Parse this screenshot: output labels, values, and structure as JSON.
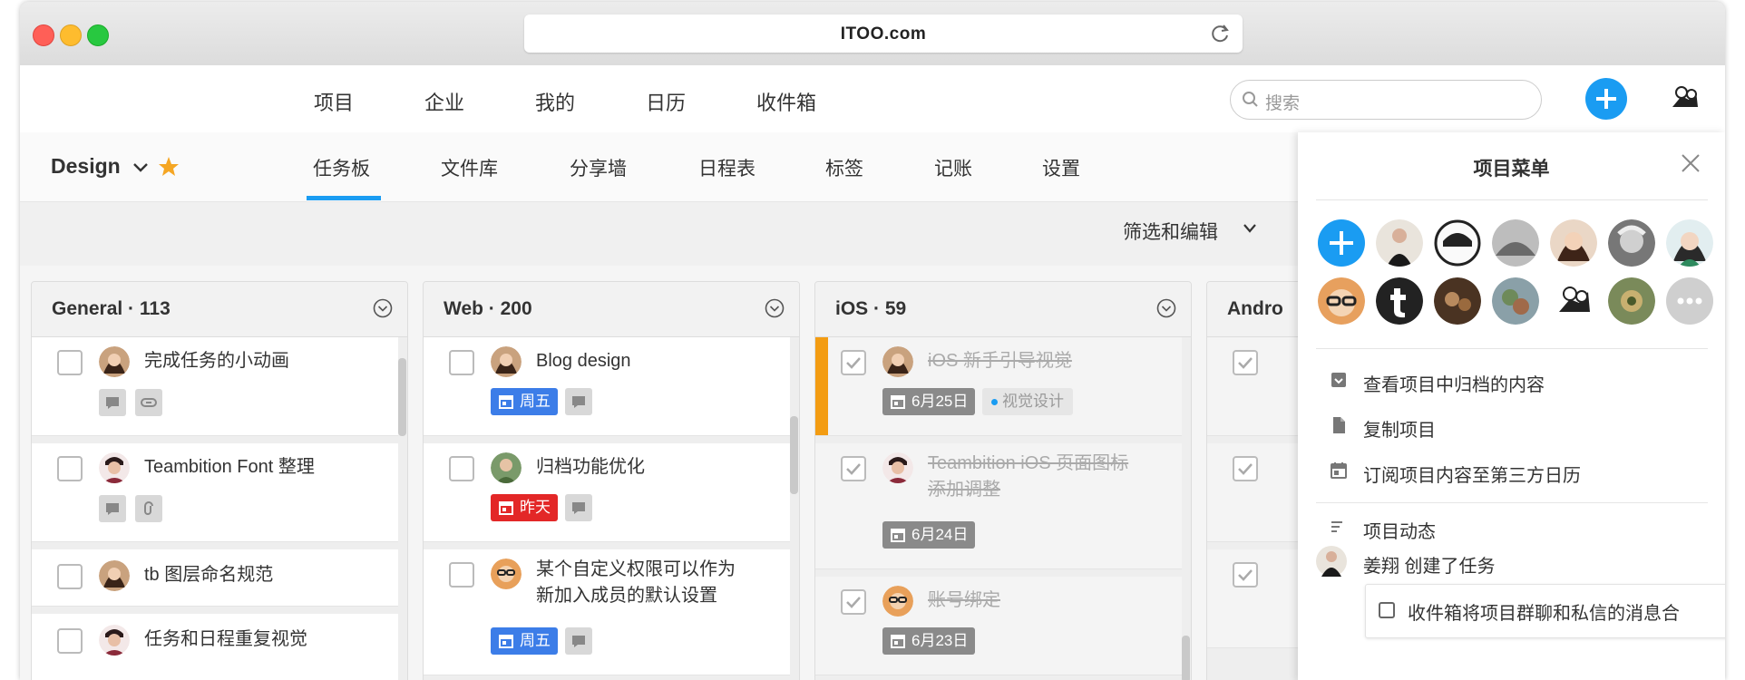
{
  "window": {
    "url": "ITOO.com"
  },
  "topnav": {
    "items": [
      "项目",
      "企业",
      "我的",
      "日历",
      "收件箱"
    ],
    "search_placeholder": "搜索"
  },
  "project": {
    "name": "Design",
    "tabs": [
      "任务板",
      "文件库",
      "分享墙",
      "日程表",
      "标签",
      "记账",
      "设置"
    ],
    "active_tab": "任务板",
    "filter_label": "筛选和编辑"
  },
  "columns": [
    {
      "title": "General · 113",
      "cards": [
        {
          "title": "完成任务的小动画",
          "done": false
        },
        {
          "title": "Teambition Font 整理",
          "done": false
        },
        {
          "title": "tb 图层命名规范",
          "done": false
        },
        {
          "title": "任务和日程重复视觉",
          "done": false
        }
      ]
    },
    {
      "title": "Web · 200",
      "cards": [
        {
          "title": "Blog design",
          "done": false,
          "date": "周五",
          "date_color": "#3c7de8"
        },
        {
          "title": "归档功能优化",
          "done": false,
          "date": "昨天",
          "date_color": "#e32727"
        },
        {
          "title_line1": "某个自定义权限可以作为",
          "title_line2": "新加入成员的默认设置",
          "done": false,
          "date": "周五",
          "date_color": "#3c7de8"
        }
      ]
    },
    {
      "title": "iOS · 59",
      "cards": [
        {
          "title": "iOS 新手引导视觉",
          "done": true,
          "date": "6月25日",
          "tag": "视觉设计",
          "priority_color": "#f39c12"
        },
        {
          "title_line1": "Teambition iOS 页面图标",
          "title_line2": "添加调整",
          "done": true,
          "date": "6月24日"
        },
        {
          "title": "账号绑定",
          "done": true,
          "date": "6月23日"
        }
      ]
    },
    {
      "title": "Andro",
      "cards": []
    }
  ],
  "panel": {
    "title": "项目菜单",
    "menu_items": [
      "查看项目中归档的内容",
      "复制项目",
      "订阅项目内容至第三方日历"
    ],
    "activity_title": "项目动态",
    "activity_user_line": "姜翔 创建了任务",
    "activity_task": "收件箱将项目群聊和私信的消息合"
  },
  "colors": {
    "accent": "#1a9cf2",
    "date_gray": "#8a8a8a",
    "star": "#f5a623"
  }
}
